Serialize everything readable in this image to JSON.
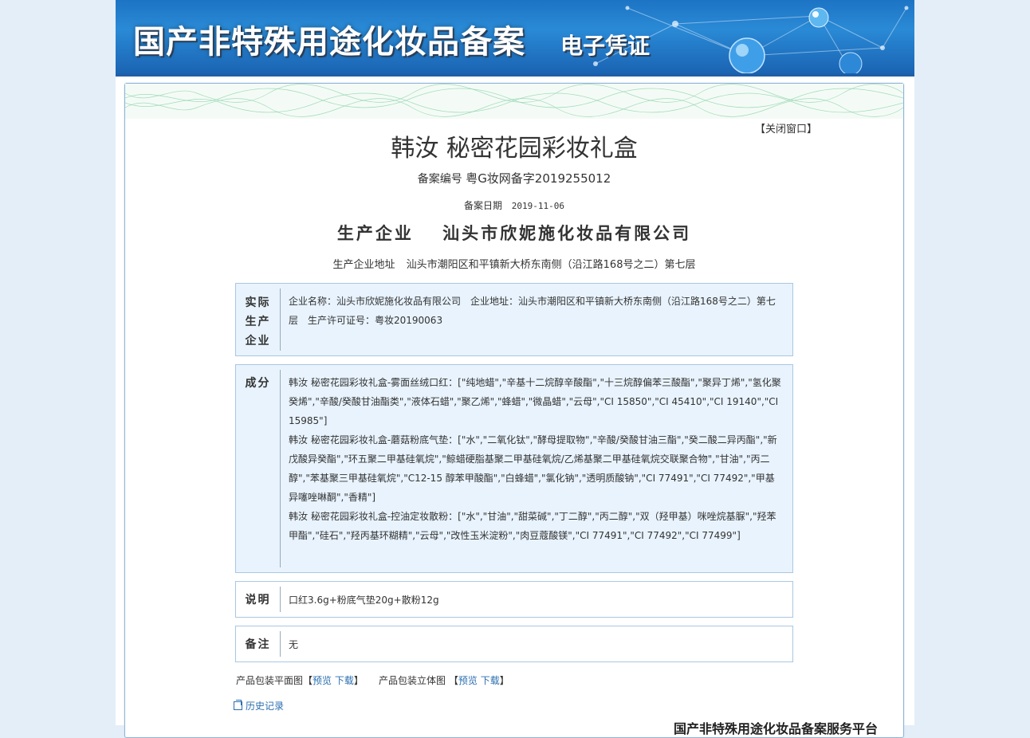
{
  "banner": {
    "title": "国产非特殊用途化妆品备案",
    "subtitle": "电子凭证"
  },
  "close_window": "【关闭窗口】",
  "product": {
    "name": "韩汝 秘密花园彩妆礼盒",
    "reg_no_label": "备案编号",
    "reg_no": "粤G妆网备字2019255012",
    "reg_date_label": "备案日期",
    "reg_date": "2019-11-06",
    "maker_label": "生产企业",
    "maker": "汕头市欣妮施化妆品有限公司",
    "maker_addr_label": "生产企业地址",
    "maker_addr": "汕头市潮阳区和平镇新大桥东南侧（沿江路168号之二）第七层"
  },
  "sections": {
    "actual_maker": {
      "label_lines": [
        "实际",
        "生产",
        "企业"
      ],
      "content": "企业名称：汕头市欣妮施化妆品有限公司　企业地址：汕头市潮阳区和平镇新大桥东南侧（沿江路168号之二）第七层　生产许可证号：粤妆20190063"
    },
    "ingredients": {
      "label": "成分",
      "lines": [
        "韩汝 秘密花园彩妆礼盒-雾面丝绒口红：[\"纯地蜡\",\"辛基十二烷醇辛酸酯\",\"十三烷醇偏苯三酸酯\",\"聚异丁烯\",\"氢化聚癸烯\",\"辛酸/癸酸甘油酯类\",\"液体石蜡\",\"聚乙烯\",\"蜂蜡\",\"微晶蜡\",\"云母\",\"CI 15850\",\"CI 45410\",\"CI 19140\",\"CI 15985\"]",
        "韩汝 秘密花园彩妆礼盒-蘑菇粉底气垫：[\"水\",\"二氧化钛\",\"酵母提取物\",\"辛酸/癸酸甘油三酯\",\"癸二酸二异丙酯\",\"新戊酸异癸酯\",\"环五聚二甲基硅氧烷\",\"鲸蜡硬脂基聚二甲基硅氧烷/乙烯基聚二甲基硅氧烷交联聚合物\",\"甘油\",\"丙二醇\",\"苯基聚三甲基硅氧烷\",\"C12-15 醇苯甲酸酯\",\"白蜂蜡\",\"氯化钠\",\"透明质酸钠\",\"CI 77491\",\"CI 77492\",\"甲基异噻唑啉酮\",\"香精\"]",
        "韩汝 秘密花园彩妆礼盒-控油定妆散粉：[\"水\",\"甘油\",\"甜菜碱\",\"丁二醇\",\"丙二醇\",\"双（羟甲基）咪唑烷基脲\",\"羟苯甲酯\",\"硅石\",\"羟丙基环糊精\",\"云母\",\"改性玉米淀粉\",\"肉豆蔻酸镁\",\"CI 77491\",\"CI 77492\",\"CI 77499\"]"
      ]
    },
    "description": {
      "label": "说明",
      "content": "口红3.6g+粉底气垫20g+散粉12g"
    },
    "remark": {
      "label": "备注",
      "content": "无"
    }
  },
  "package": {
    "flat_label": "产品包装平面图",
    "flat_open": "【",
    "preview": "预览",
    "download": "下载",
    "close": "】",
    "solid_label": "产品包装立体图",
    "solid_open": "【"
  },
  "history_link": "历史记录",
  "footer_title": "国产非特殊用途化妆品备案服务平台",
  "colors": {
    "banner": "#1d74c4",
    "section_blue": "#e8f3fd",
    "border": "#a9c7e2",
    "link": "#2a6fb0"
  }
}
